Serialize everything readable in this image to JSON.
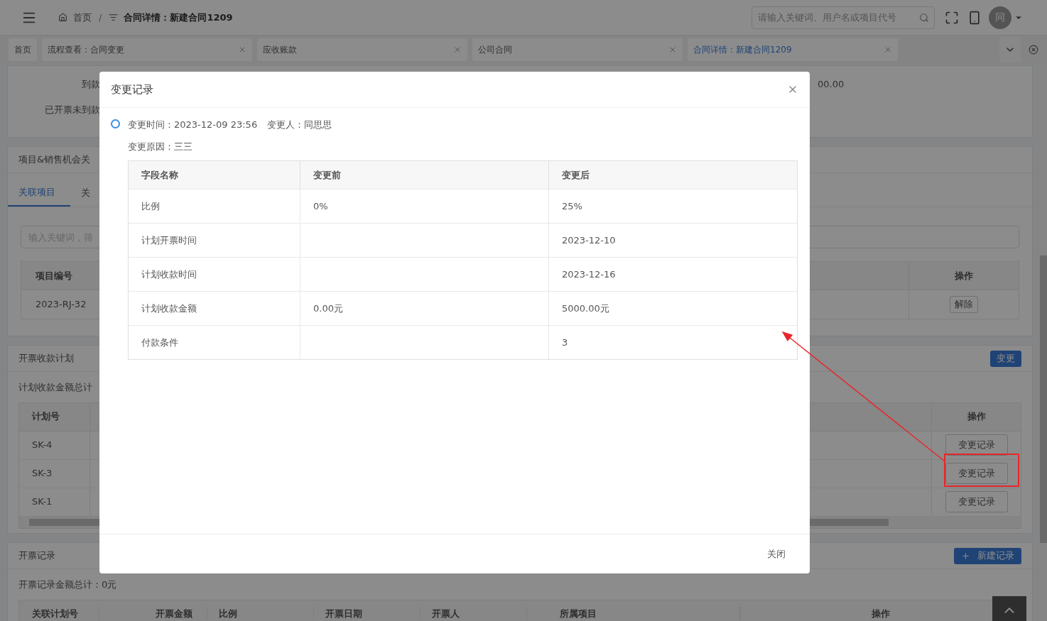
{
  "header": {
    "separator": "/",
    "breadcrumb": [
      {
        "label": "首页",
        "kind": "home"
      },
      {
        "label": "合同详情：新建合同1209",
        "kind": "filter"
      }
    ],
    "search": {
      "placeholder": "请输入关键词、用户名或项目代号"
    },
    "avatar": "同"
  },
  "tabs": [
    {
      "label": "首页",
      "selected": false,
      "closable": false
    },
    {
      "label": "流程查看：合同变更",
      "selected": false,
      "closable": true
    },
    {
      "label": "应收账款",
      "selected": false,
      "closable": true
    },
    {
      "label": "公司合同",
      "selected": false,
      "closable": true
    },
    {
      "label": "合同详情：新建合同1209",
      "selected": true,
      "closable": true
    }
  ],
  "summary": {
    "labels": [
      "到款",
      "已开票未到款"
    ],
    "value": "00.00"
  },
  "related": {
    "title": "项目&销售机会关",
    "tabs": [
      {
        "label": "关联项目",
        "selected": true
      },
      {
        "label": "关",
        "selected": false
      }
    ],
    "search": {
      "placeholder": "输入关键词，筛"
    },
    "columns": [
      "项目编号",
      "操作"
    ],
    "rows": [
      {
        "code": "2023-RJ-32",
        "action": "解除"
      }
    ]
  },
  "plan": {
    "title": "开票收款计划",
    "button": "变更",
    "total_label": "计划收款金额总计",
    "columns": [
      "计划号",
      "操作"
    ],
    "rows": [
      {
        "code": "SK-4",
        "action": "变更记录",
        "highlighted": false
      },
      {
        "code": "SK-3",
        "action": "变更记录",
        "highlighted": true
      },
      {
        "code": "SK-1",
        "action": "变更记录",
        "highlighted": false
      }
    ]
  },
  "invoices": {
    "title": "开票记录",
    "button": "新建记录",
    "total": "开票记录金额总计：0元",
    "columns": [
      "关联计划号",
      "开票金额",
      "比例",
      "开票日期",
      "开票人",
      "所属项目",
      "操作"
    ]
  },
  "dialog": {
    "title": "变更记录",
    "entries": [
      {
        "time": "变更时间：2023-12-09 23:56",
        "person": "变更人：同思思",
        "reason": "变更原因：三三",
        "columns": [
          "字段名称",
          "变更前",
          "变更后"
        ],
        "rows": [
          [
            "比例",
            "0%",
            "25%"
          ],
          [
            "计划开票时间",
            "",
            "2023-12-10"
          ],
          [
            "计划收款时间",
            "",
            "2023-12-16"
          ],
          [
            "计划收款金额",
            "0.00元",
            "5000.00元"
          ],
          [
            "付款条件",
            "",
            "3"
          ]
        ]
      }
    ],
    "close": "关闭"
  }
}
